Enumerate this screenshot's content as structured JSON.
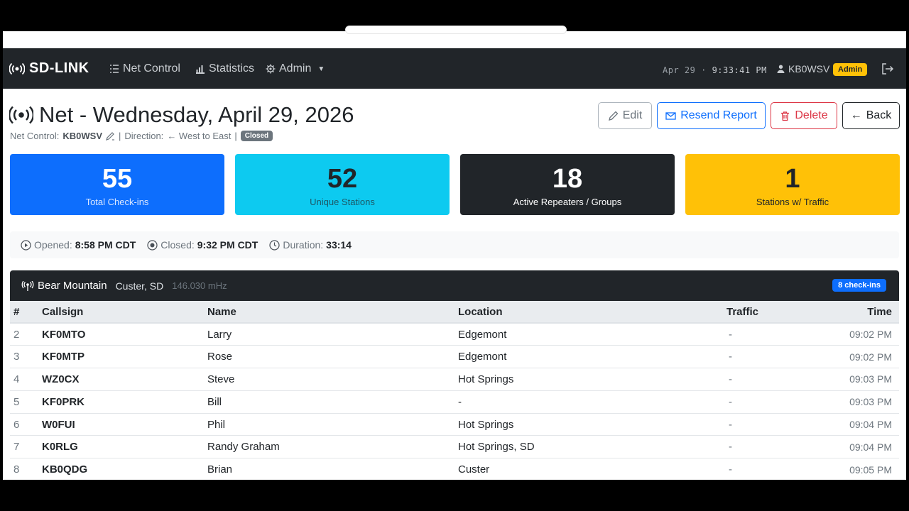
{
  "navbar": {
    "brand": "SD-LINK",
    "items": [
      {
        "label": "Net Control",
        "icon": "list-icon"
      },
      {
        "label": "Statistics",
        "icon": "bar-chart-icon"
      },
      {
        "label": "Admin",
        "icon": "gear-icon"
      }
    ],
    "date": "Apr 29",
    "separator": "·",
    "time": "9:33:41 PM",
    "user": "KB0WSV",
    "role_badge": "Admin"
  },
  "header": {
    "title": "Net - Wednesday, April 29, 2026",
    "net_control_label": "Net Control:",
    "net_control_value": "KB0WSV",
    "direction_label": "Direction:",
    "direction_value": "← West to East",
    "status_badge": "Closed"
  },
  "actions": {
    "edit": "Edit",
    "resend": "Resend Report",
    "delete": "Delete",
    "back": "Back"
  },
  "stats": [
    {
      "value": "55",
      "label": "Total Check-ins",
      "color": "#0d6efd"
    },
    {
      "value": "52",
      "label": "Unique Stations",
      "color": "#0dcaf0"
    },
    {
      "value": "18",
      "label": "Active Repeaters / Groups",
      "color": "#212529"
    },
    {
      "value": "1",
      "label": "Stations w/ Traffic",
      "color": "#ffc107"
    }
  ],
  "times": {
    "opened_label": "Opened:",
    "opened_value": "8:58 PM CDT",
    "closed_label": "Closed:",
    "closed_value": "9:32 PM CDT",
    "duration_label": "Duration:",
    "duration_value": "33:14"
  },
  "group": {
    "name": "Bear Mountain",
    "location": "Custer, SD",
    "frequency": "146.030 mHz",
    "checkins_badge": "8 check-ins"
  },
  "table": {
    "headers": [
      "#",
      "Callsign",
      "Name",
      "Location",
      "Traffic",
      "Time"
    ],
    "rows": [
      {
        "num": "2",
        "call": "KF0MTO",
        "name": "Larry",
        "loc": "Edgemont",
        "traffic": "-",
        "time": "09:02 PM"
      },
      {
        "num": "3",
        "call": "KF0MTP",
        "name": "Rose",
        "loc": "Edgemont",
        "traffic": "-",
        "time": "09:02 PM"
      },
      {
        "num": "4",
        "call": "WZ0CX",
        "name": "Steve",
        "loc": "Hot Springs",
        "traffic": "-",
        "time": "09:03 PM"
      },
      {
        "num": "5",
        "call": "KF0PRK",
        "name": "Bill",
        "loc": "-",
        "traffic": "-",
        "time": "09:03 PM"
      },
      {
        "num": "6",
        "call": "W0FUI",
        "name": "Phil",
        "loc": "Hot Springs",
        "traffic": "-",
        "time": "09:04 PM"
      },
      {
        "num": "7",
        "call": "K0RLG",
        "name": "Randy Graham",
        "loc": "Hot Springs, SD",
        "traffic": "-",
        "time": "09:04 PM"
      },
      {
        "num": "8",
        "call": "KB0QDG",
        "name": "Brian",
        "loc": "Custer",
        "traffic": "-",
        "time": "09:05 PM"
      }
    ]
  }
}
